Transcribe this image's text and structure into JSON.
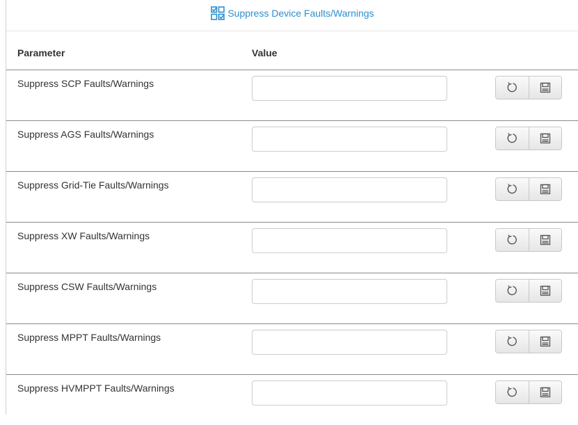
{
  "header": {
    "title": "Suppress Device Faults/Warnings",
    "icon": "checkbox-grid-icon",
    "accent_color": "#2a8fd0"
  },
  "table": {
    "columns": [
      "Parameter",
      "Value"
    ],
    "rows": [
      {
        "label": "Suppress SCP Faults/Warnings",
        "value": ""
      },
      {
        "label": "Suppress AGS Faults/Warnings",
        "value": ""
      },
      {
        "label": "Suppress Grid-Tie Faults/Warnings",
        "value": ""
      },
      {
        "label": "Suppress XW Faults/Warnings",
        "value": ""
      },
      {
        "label": "Suppress CSW Faults/Warnings",
        "value": ""
      },
      {
        "label": "Suppress MPPT Faults/Warnings",
        "value": ""
      },
      {
        "label": "Suppress HVMPPT Faults/Warnings",
        "value": ""
      }
    ],
    "row_actions": [
      "refresh-icon",
      "save-icon"
    ]
  }
}
